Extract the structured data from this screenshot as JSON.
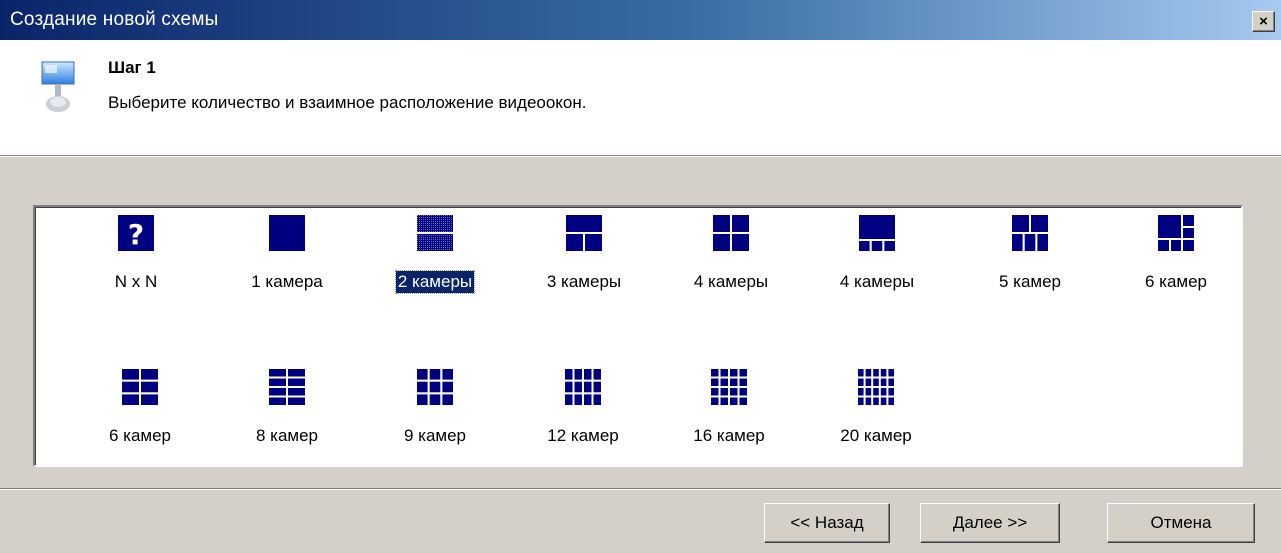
{
  "window": {
    "title": "Создание новой схемы",
    "close_label": "×"
  },
  "header": {
    "step_title": "Шаг 1",
    "description": "Выберите количество и взаимное расположение видеоокон."
  },
  "layouts": [
    {
      "label": "N x N",
      "icon": "question-layout-icon",
      "selected": false
    },
    {
      "label": "1 камера",
      "icon": "layout-1-icon",
      "selected": false
    },
    {
      "label": "2 камеры",
      "icon": "layout-2-icon",
      "selected": true
    },
    {
      "label": "3 камеры",
      "icon": "layout-3-icon",
      "selected": false
    },
    {
      "label": "4 камеры",
      "icon": "layout-4-icon",
      "selected": false
    },
    {
      "label": "4 камеры",
      "icon": "layout-4b-icon",
      "selected": false
    },
    {
      "label": "5 камер",
      "icon": "layout-5-icon",
      "selected": false
    },
    {
      "label": "6 камер",
      "icon": "layout-6-icon",
      "selected": false
    },
    {
      "label": "6 камер",
      "icon": "layout-6b-icon",
      "selected": false
    },
    {
      "label": "8 камер",
      "icon": "layout-8-icon",
      "selected": false
    },
    {
      "label": "9 камер",
      "icon": "layout-9-icon",
      "selected": false
    },
    {
      "label": "12 камер",
      "icon": "layout-12-icon",
      "selected": false
    },
    {
      "label": "16 камер",
      "icon": "layout-16-icon",
      "selected": false
    },
    {
      "label": "20 камер",
      "icon": "layout-20-icon",
      "selected": false
    }
  ],
  "buttons": {
    "back": "<< Назад",
    "next": "Далее >>",
    "cancel": "Отмена"
  },
  "colors": {
    "accent": "#000080",
    "selection": "#0a246a",
    "titlebar_start": "#0a246a",
    "titlebar_end": "#a6caf0"
  }
}
